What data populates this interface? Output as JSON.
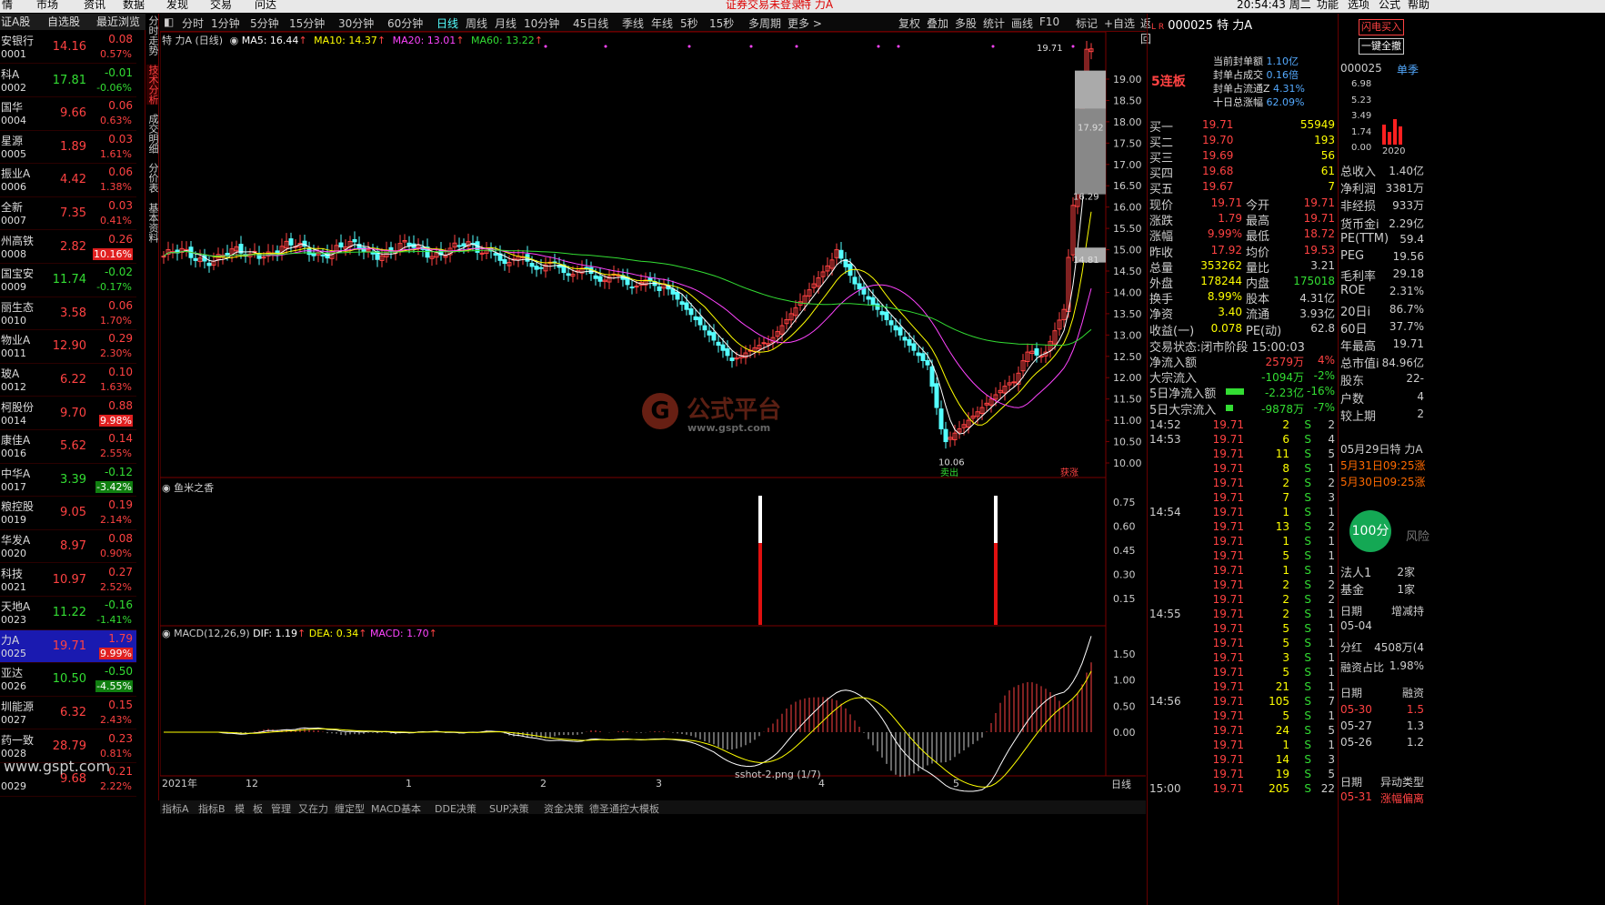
{
  "menubar": {
    "items": [
      "情",
      "市场",
      "资讯",
      "数据",
      "发现",
      "交易",
      "问达"
    ],
    "notice": "证券交易未登录",
    "notice_stock": "特 力A",
    "clock": "20:54:43 周二",
    "right_items": [
      "功能",
      "选项",
      "公式",
      "帮助"
    ]
  },
  "left_header": {
    "col1": "证A股",
    "col2": "自选股",
    "col3": "最近浏览"
  },
  "stocks": [
    {
      "name": "安银行",
      "code": "0001",
      "price": "14.16",
      "chg": "0.08",
      "pct": "0.57%",
      "dir": "up"
    },
    {
      "name": "科A",
      "code": "0002",
      "price": "17.81",
      "chg": "-0.01",
      "pct": "-0.06%",
      "dir": "dn"
    },
    {
      "name": "国华",
      "code": "0004",
      "price": "9.66",
      "chg": "0.06",
      "pct": "0.63%",
      "dir": "up"
    },
    {
      "name": "星源",
      "code": "0005",
      "price": "1.89",
      "chg": "0.03",
      "pct": "1.61%",
      "dir": "up"
    },
    {
      "name": "振业A",
      "code": "0006",
      "price": "4.42",
      "chg": "0.06",
      "pct": "1.38%",
      "dir": "up"
    },
    {
      "name": "全新",
      "code": "0007",
      "price": "7.35",
      "chg": "0.03",
      "pct": "0.41%",
      "dir": "up"
    },
    {
      "name": "州高铁",
      "code": "0008",
      "price": "2.82",
      "chg": "0.26",
      "pct": "10.16%",
      "dir": "up",
      "hl": true
    },
    {
      "name": "国宝安",
      "code": "0009",
      "price": "11.74",
      "chg": "-0.02",
      "pct": "-0.17%",
      "dir": "dn"
    },
    {
      "name": "丽生态",
      "code": "0010",
      "price": "3.58",
      "chg": "0.06",
      "pct": "1.70%",
      "dir": "up"
    },
    {
      "name": "物业A",
      "code": "0011",
      "price": "12.90",
      "chg": "0.29",
      "pct": "2.30%",
      "dir": "up"
    },
    {
      "name": "玻A",
      "code": "0012",
      "price": "6.22",
      "chg": "0.10",
      "pct": "1.63%",
      "dir": "up"
    },
    {
      "name": "柯股份",
      "code": "0014",
      "price": "9.70",
      "chg": "0.88",
      "pct": "9.98%",
      "dir": "up",
      "hl": true
    },
    {
      "name": "康佳A",
      "code": "0016",
      "price": "5.62",
      "chg": "0.14",
      "pct": "2.55%",
      "dir": "up"
    },
    {
      "name": "中华A",
      "code": "0017",
      "price": "3.39",
      "chg": "-0.12",
      "pct": "-3.42%",
      "dir": "dn",
      "hl": true
    },
    {
      "name": "粮控股",
      "code": "0019",
      "price": "9.05",
      "chg": "0.19",
      "pct": "2.14%",
      "dir": "up"
    },
    {
      "name": "华发A",
      "code": "0020",
      "price": "8.97",
      "chg": "0.08",
      "pct": "0.90%",
      "dir": "up"
    },
    {
      "name": "科技",
      "code": "0021",
      "price": "10.97",
      "chg": "0.27",
      "pct": "2.52%",
      "dir": "up"
    },
    {
      "name": "天地A",
      "code": "0023",
      "price": "11.22",
      "chg": "-0.16",
      "pct": "-1.41%",
      "dir": "dn"
    },
    {
      "name": "力A",
      "code": "0025",
      "price": "19.71",
      "chg": "1.79",
      "pct": "9.99%",
      "dir": "up",
      "hl": true,
      "sel": true
    },
    {
      "name": "亚达",
      "code": "0026",
      "price": "10.50",
      "chg": "-0.50",
      "pct": "-4.55%",
      "dir": "dn",
      "hl": true
    },
    {
      "name": "圳能源",
      "code": "0027",
      "price": "6.32",
      "chg": "0.15",
      "pct": "2.43%",
      "dir": "up"
    },
    {
      "name": "药一致",
      "code": "0028",
      "price": "28.79",
      "chg": "0.23",
      "pct": "0.81%",
      "dir": "up"
    },
    {
      "name": "",
      "code": "0029",
      "price": "9.68",
      "chg": "0.21",
      "pct": "2.22%",
      "dir": "up"
    }
  ],
  "watermark_site": "www.gspt.com",
  "vertical_tabs": [
    "分时走势",
    "技术分析",
    "成交明细",
    "分价表",
    "基本资料"
  ],
  "toolbar": {
    "periods": [
      "分时",
      "1分钟",
      "5分钟",
      "15分钟",
      "30分钟",
      "60分钟",
      "日线",
      "周线",
      "月线",
      "10分钟",
      "45日线",
      "季线",
      "年线",
      "5秒",
      "15秒",
      "多周期",
      "更多 >"
    ],
    "tools": [
      "复权",
      "叠加",
      "多股",
      "统计",
      "画线",
      "F10",
      "标记",
      "+自选",
      "返回"
    ]
  },
  "kline": {
    "title": "特 力A (日线)",
    "ma5": "MA5: 16.44",
    "ma10": "MA10: 14.37",
    "ma20": "MA20: 13.01",
    "ma60": "MA60: 13.22",
    "high_label": "19.71",
    "low_label": "10.06",
    "box1": "17.92",
    "box2": "16.29",
    "box3": "14.81",
    "sell_tag": "卖出",
    "buy_tag": "获涨",
    "yticks": [
      "19.00",
      "18.50",
      "18.00",
      "17.50",
      "17.00",
      "16.50",
      "16.00",
      "15.50",
      "15.00",
      "14.50",
      "14.00",
      "13.50",
      "13.00",
      "12.50",
      "12.00",
      "11.50",
      "11.00",
      "10.50",
      "10.00"
    ]
  },
  "indicator": {
    "title": "鱼米之香",
    "yticks": [
      "0.75",
      "0.60",
      "0.45",
      "0.30",
      "0.15"
    ]
  },
  "macd": {
    "title": "MACD(12,26,9)",
    "dif": "DIF: 1.19",
    "dea": "DEA: 0.34",
    "macd": "MACD: 1.70",
    "yticks": [
      "1.50",
      "1.00",
      "0.50",
      "0.00"
    ]
  },
  "xaxis": {
    "labels": [
      "2021年",
      "12",
      "1",
      "2",
      "3",
      "4",
      "5"
    ],
    "tag": "日线"
  },
  "status": {
    "file": "sshot-2.png (1/7)"
  },
  "bottom_tabs": [
    "指标A",
    "指标B",
    "模",
    "板",
    "管理",
    "又在力",
    "缠定型",
    "MACD基本",
    "DDE决策",
    "SUP决策",
    "资金决策",
    "德圣通控大模板"
  ],
  "watermark": {
    "main": "公式平台",
    "sub": "www.gspt.com"
  },
  "quote": {
    "code": "000025",
    "name": "特 力A",
    "limit_text": "5连板",
    "seal_amount_label": "当前封单额",
    "seal_amount": "1.10亿",
    "seal_vol_label": "封单占成交",
    "seal_vol": "0.16倍",
    "seal_float_label": "封单占流通Z",
    "seal_float": "4.31%",
    "ten_day_label": "十日总涨幅",
    "ten_day": "62.09%",
    "buys": [
      {
        "l": "买一",
        "p": "19.71",
        "v": "55949"
      },
      {
        "l": "买二",
        "p": "19.70",
        "v": "193"
      },
      {
        "l": "买三",
        "p": "19.69",
        "v": "56"
      },
      {
        "l": "买四",
        "p": "19.68",
        "v": "61"
      },
      {
        "l": "买五",
        "p": "19.67",
        "v": "7"
      }
    ],
    "stats": [
      [
        "现价",
        "19.71",
        "今开",
        "19.71"
      ],
      [
        "涨跌",
        "1.79",
        "最高",
        "19.71"
      ],
      [
        "涨幅",
        "9.99%",
        "最低",
        "18.72"
      ],
      [
        "昨收",
        "17.92",
        "均价",
        "19.53"
      ],
      [
        "总量",
        "353262",
        "量比",
        "3.21"
      ],
      [
        "外盘",
        "178244",
        "内盘",
        "175018"
      ],
      [
        "换手",
        "8.99%",
        "股本",
        "4.31亿"
      ],
      [
        "净资",
        "3.40",
        "流通",
        "3.93亿"
      ],
      [
        "收益(一)",
        "0.078",
        "PE(动)",
        "62.8"
      ]
    ],
    "trade_status_label": "交易状态:",
    "trade_status": "闭市阶段 15:00:03",
    "flows": [
      [
        "净流入额",
        "2579万",
        "4%"
      ],
      [
        "大宗流入",
        "-1094万",
        "-2%"
      ],
      [
        "5日净流入额",
        "-2.23亿",
        "-16%"
      ],
      [
        "5日大宗流入",
        "-9878万",
        "-7%"
      ]
    ],
    "ticks": [
      [
        "14:52",
        "19.71",
        "2",
        "S",
        "2"
      ],
      [
        "14:53",
        "19.71",
        "6",
        "S",
        "4"
      ],
      [
        "",
        "19.71",
        "11",
        "S",
        "5"
      ],
      [
        "",
        "19.71",
        "8",
        "S",
        "1"
      ],
      [
        "",
        "19.71",
        "2",
        "S",
        "2"
      ],
      [
        "",
        "19.71",
        "7",
        "S",
        "3"
      ],
      [
        "14:54",
        "19.71",
        "1",
        "S",
        "1"
      ],
      [
        "",
        "19.71",
        "13",
        "S",
        "2"
      ],
      [
        "",
        "19.71",
        "1",
        "S",
        "1"
      ],
      [
        "",
        "19.71",
        "5",
        "S",
        "1"
      ],
      [
        "",
        "19.71",
        "1",
        "S",
        "1"
      ],
      [
        "",
        "19.71",
        "2",
        "S",
        "2"
      ],
      [
        "",
        "19.71",
        "2",
        "S",
        "2"
      ],
      [
        "14:55",
        "19.71",
        "2",
        "S",
        "1"
      ],
      [
        "",
        "19.71",
        "5",
        "S",
        "1"
      ],
      [
        "",
        "19.71",
        "5",
        "S",
        "1"
      ],
      [
        "",
        "19.71",
        "3",
        "S",
        "1"
      ],
      [
        "",
        "19.71",
        "5",
        "S",
        "1"
      ],
      [
        "",
        "19.71",
        "21",
        "S",
        "1"
      ],
      [
        "14:56",
        "19.71",
        "105",
        "S",
        "7"
      ],
      [
        "",
        "19.71",
        "5",
        "S",
        "1"
      ],
      [
        "",
        "19.71",
        "24",
        "S",
        "5"
      ],
      [
        "",
        "19.71",
        "1",
        "S",
        "1"
      ],
      [
        "",
        "19.71",
        "14",
        "S",
        "3"
      ],
      [
        "",
        "19.71",
        "19",
        "S",
        "5"
      ],
      [
        "15:00",
        "19.71",
        "205",
        "S",
        "22"
      ]
    ]
  },
  "farright": {
    "btn1": "闪电买入",
    "btn2": "一键全撤",
    "code": "000025",
    "tab": "单季",
    "chart_vals": [
      "6.98",
      "5.23",
      "3.49",
      "1.74",
      "0.00"
    ],
    "chart_year": "2020",
    "fin": [
      [
        "总收入",
        "1.40亿"
      ],
      [
        "净利润",
        "3381万"
      ],
      [
        "非经损",
        "933万"
      ],
      [
        "货币金i",
        "2.29亿"
      ],
      [
        "PE(TTM)",
        "59.4"
      ],
      [
        "PEG",
        "19.56"
      ],
      [
        "毛利率",
        "29.18"
      ],
      [
        "ROE",
        "2.31%"
      ],
      [
        "20日i",
        "86.7%"
      ],
      [
        "60日",
        "37.7%"
      ],
      [
        "年最高",
        "19.71"
      ],
      [
        "总市值i",
        "84.96亿"
      ],
      [
        "股东",
        "22-"
      ],
      [
        "户数",
        "4"
      ],
      [
        "较上期",
        "2"
      ]
    ],
    "news": [
      "05月29日特 力A",
      "5月31日09:25涨",
      "5月30日09:25涨"
    ],
    "score": "100分",
    "risk": "风险",
    "inst": [
      [
        "法人1",
        "2家"
      ],
      [
        "基金",
        "1家"
      ]
    ],
    "date_label": "日期",
    "date_col2": "增减持",
    "date": "05-04",
    "div_label": "分红",
    "div": "4508万(4",
    "margin_label": "融资占比",
    "margin": "1.98%",
    "md_label": "日期",
    "md_col2": "融资",
    "md_rows": [
      [
        "05-30",
        "1.5"
      ],
      [
        "05-27",
        "1.3"
      ],
      [
        "05-26",
        "1.2"
      ]
    ],
    "abn_label": "日期",
    "abn_col2": "异动类型",
    "abn_date": "05-31",
    "abn_type": "涨幅偏离"
  },
  "colors": {
    "up": "#ff4242",
    "down": "#33dd33",
    "cyan": "#54ffff",
    "gridred": "#7a0000",
    "ma5": "#ffffff",
    "ma10": "#ffff00",
    "ma20": "#ff44ff",
    "ma60": "#33dd33"
  }
}
